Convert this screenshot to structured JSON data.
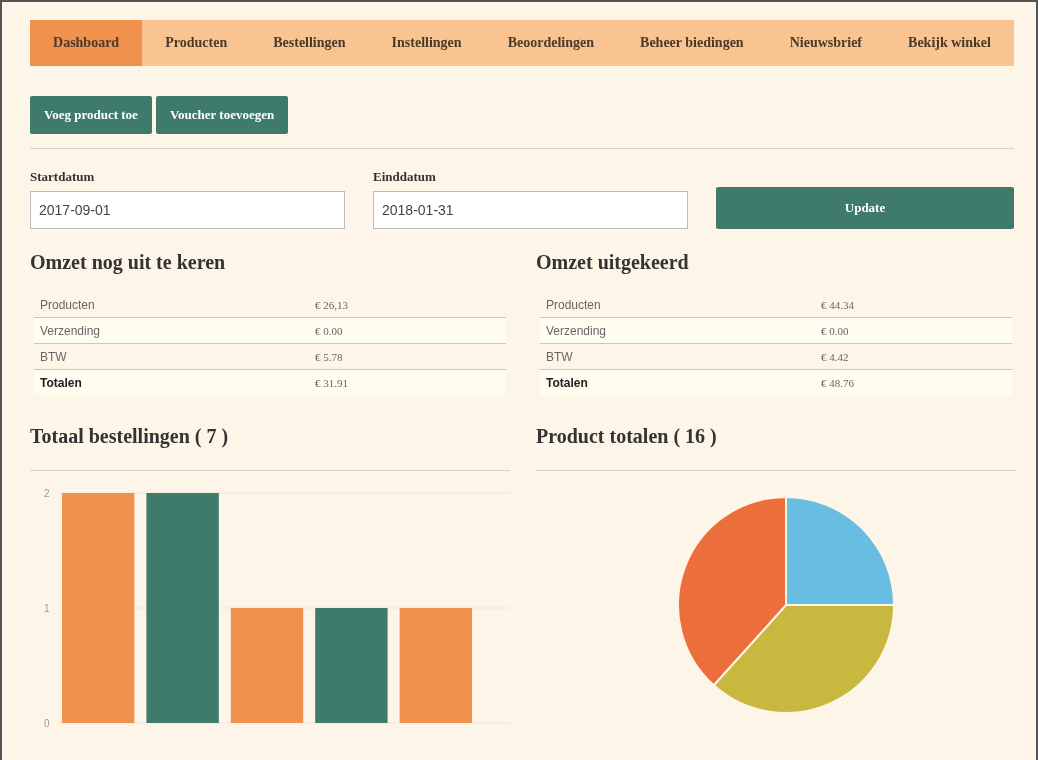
{
  "nav": [
    {
      "label": "Dashboard",
      "selected": true
    },
    {
      "label": "Producten",
      "selected": false
    },
    {
      "label": "Bestellingen",
      "selected": false
    },
    {
      "label": "Instellingen",
      "selected": false
    },
    {
      "label": "Beoordelingen",
      "selected": false
    },
    {
      "label": "Beheer biedingen",
      "selected": false
    },
    {
      "label": "Nieuwsbrief",
      "selected": false
    },
    {
      "label": "Bekijk winkel",
      "selected": false
    }
  ],
  "actions": [
    "Voeg product toe",
    "Voucher toevoegen"
  ],
  "filters": {
    "start": {
      "label": "Startdatum",
      "value": "2017-09-01"
    },
    "end": {
      "label": "Einddatum",
      "value": "2018-01-31"
    },
    "button": "Update"
  },
  "summaries": [
    {
      "title": "Omzet nog uit te keren",
      "rows": [
        {
          "label": "Producten",
          "value": "€ 26,13",
          "total": false
        },
        {
          "label": "Verzending",
          "value": "€ 0.00",
          "total": false
        },
        {
          "label": "BTW",
          "value": "€ 5.78",
          "total": false
        },
        {
          "label": "Totalen",
          "value": "€ 31.91",
          "total": true
        }
      ]
    },
    {
      "title": "Omzet uitgekeerd",
      "rows": [
        {
          "label": "Producten",
          "value": "€ 44.34",
          "total": false
        },
        {
          "label": "Verzending",
          "value": "€ 0.00",
          "total": false
        },
        {
          "label": "BTW",
          "value": "€ 4.42",
          "total": false
        },
        {
          "label": "Totalen",
          "value": "€ 48.76",
          "total": true
        }
      ]
    }
  ],
  "orders": {
    "title": "Totaal bestellingen ( 7 )",
    "chart_data": {
      "type": "bar",
      "ylim": [
        0,
        2
      ],
      "yticks": [
        0,
        1,
        2
      ],
      "series": [
        {
          "color": "#f0914e",
          "values": [
            2,
            null,
            1,
            null,
            1
          ]
        },
        {
          "color": "#3f7b6b",
          "values": [
            null,
            2,
            null,
            1,
            null
          ]
        }
      ]
    }
  },
  "products": {
    "title": "Product totalen ( 16 )"
  }
}
